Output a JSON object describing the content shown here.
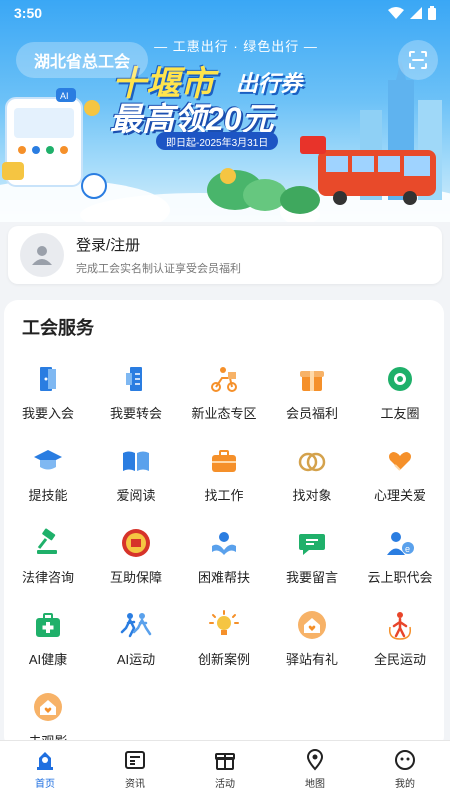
{
  "status_bar": {
    "time": "3:50"
  },
  "banner": {
    "union_name": "湖北省总工会",
    "subtitle": "— 工惠出行 · 绿色出行 —",
    "title_city": "十堰市",
    "title_suffix": "出行券",
    "headline": "最高领20元",
    "date_range": "即日起-2025年3月31日"
  },
  "login": {
    "title": "登录/注册",
    "subtitle": "完成工会实名制认证享受会员福利"
  },
  "services": {
    "title": "工会服务",
    "items": [
      {
        "label": "我要入会",
        "icon": "door-icon"
      },
      {
        "label": "我要转会",
        "icon": "door-transfer-icon"
      },
      {
        "label": "新业态专区",
        "icon": "delivery-rider-icon"
      },
      {
        "label": "会员福利",
        "icon": "gift-box-icon"
      },
      {
        "label": "工友圈",
        "icon": "camera-circle-icon"
      },
      {
        "label": "提技能",
        "icon": "graduation-cap-icon"
      },
      {
        "label": "爱阅读",
        "icon": "open-book-icon"
      },
      {
        "label": "找工作",
        "icon": "briefcase-icon"
      },
      {
        "label": "找对象",
        "icon": "rings-icon"
      },
      {
        "label": "心理关爱",
        "icon": "heart-hands-icon"
      },
      {
        "label": "法律咨询",
        "icon": "gavel-icon"
      },
      {
        "label": "互助保障",
        "icon": "union-emblem-icon"
      },
      {
        "label": "困难帮扶",
        "icon": "helping-hands-icon"
      },
      {
        "label": "我要留言",
        "icon": "chat-bubble-icon"
      },
      {
        "label": "云上职代会",
        "icon": "user-e-icon"
      },
      {
        "label": "AI健康",
        "icon": "first-aid-kit-icon"
      },
      {
        "label": "AI运动",
        "icon": "runners-icon"
      },
      {
        "label": "创新案例",
        "icon": "lightbulb-icon"
      },
      {
        "label": "驿站有礼",
        "icon": "house-heart-icon"
      },
      {
        "label": "全民运动",
        "icon": "jump-rope-icon"
      },
      {
        "label": "未观影",
        "icon": "house-heart-icon"
      }
    ]
  },
  "nav": {
    "items": [
      {
        "label": "首页",
        "icon": "union-home-icon",
        "active": true
      },
      {
        "label": "资讯",
        "icon": "news-icon"
      },
      {
        "label": "活动",
        "icon": "activity-gift-icon"
      },
      {
        "label": "地图",
        "icon": "map-pin-icon"
      },
      {
        "label": "我的",
        "icon": "face-icon"
      }
    ]
  },
  "colors": {
    "primary": "#1f6fe0",
    "banner_sky": "#3aa7f5",
    "orange": "#f5902a",
    "green": "#1fb06a",
    "blue": "#2a7de1"
  }
}
